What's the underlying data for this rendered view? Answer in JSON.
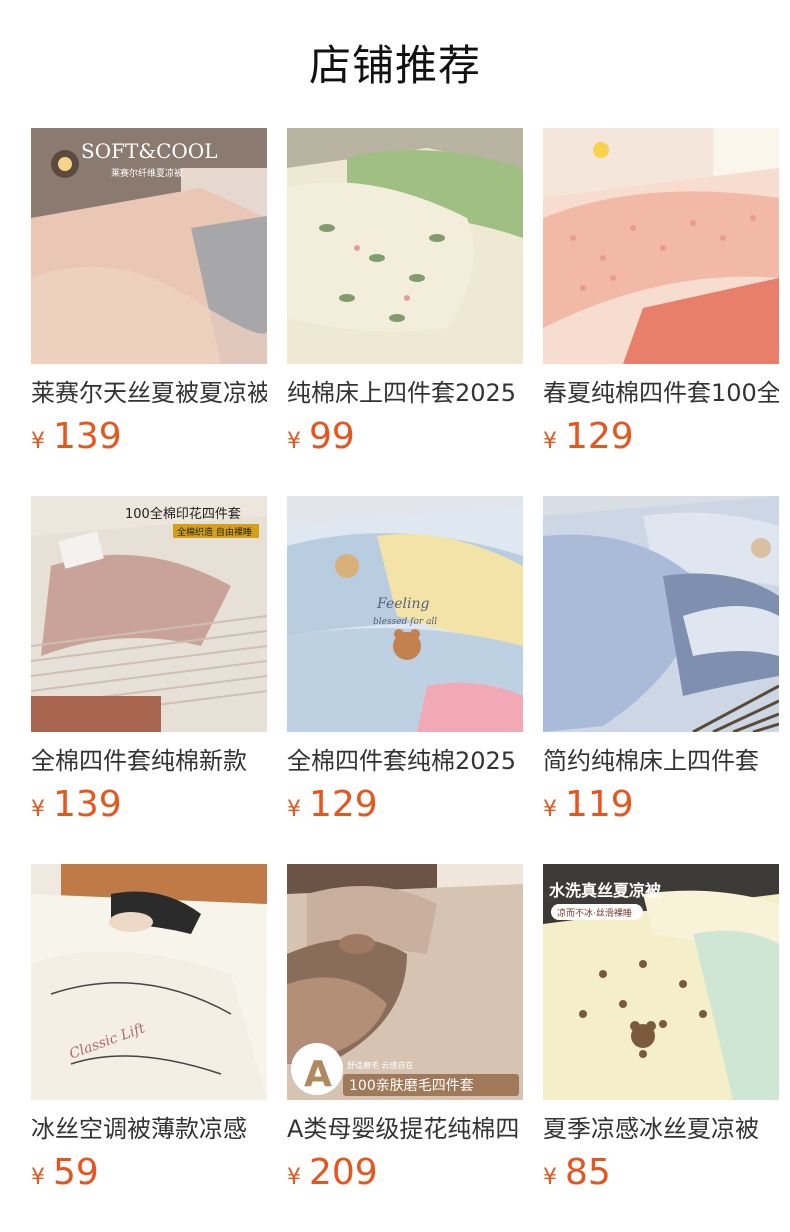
{
  "page": {
    "title": "店铺推荐"
  },
  "currency_symbol": "¥",
  "products": [
    {
      "name": "莱赛尔天丝夏被夏凉被",
      "price": "139",
      "image_text": {
        "headline": "SOFT&COOL",
        "sub": "莱赛尔纤维夏凉被"
      },
      "palette": [
        "#e9c7b4",
        "#a7a6a8",
        "#5b4a3f"
      ],
      "icon": "bedding-photo-icon"
    },
    {
      "name": "纯棉床上四件套2025",
      "price": "99",
      "image_text": {},
      "palette": [
        "#efe9d4",
        "#9fbf83",
        "#6f8f5a"
      ],
      "icon": "bedding-photo-icon"
    },
    {
      "name": "春夏纯棉四件套100全",
      "price": "129",
      "image_text": {},
      "palette": [
        "#f2b9a6",
        "#e77f6b",
        "#f7dcd0"
      ],
      "icon": "bedding-photo-icon"
    },
    {
      "name": "全棉四件套纯棉新款",
      "price": "139",
      "image_text": {
        "headline": "100全棉印花四件套",
        "sub": "全棉织造 自由裸睡"
      },
      "palette": [
        "#c9a39a",
        "#e7e0d6",
        "#8f6d63"
      ],
      "icon": "bedding-photo-icon"
    },
    {
      "name": "全棉四件套纯棉2025",
      "price": "129",
      "image_text": {
        "headline": "Feeling",
        "sub": "blessed for all"
      },
      "palette": [
        "#b8cde0",
        "#f4e3a6",
        "#c2814f"
      ],
      "icon": "bedding-photo-icon"
    },
    {
      "name": "简约纯棉床上四件套",
      "price": "119",
      "image_text": {},
      "palette": [
        "#a9bbd9",
        "#dfe6ef",
        "#7e8fb0"
      ],
      "icon": "bedding-photo-icon"
    },
    {
      "name": "冰丝空调被薄款凉感",
      "price": "59",
      "image_text": {
        "headline": "Classic Lift",
        "sub": ""
      },
      "palette": [
        "#f7f4ec",
        "#c07a48",
        "#e7e1d3"
      ],
      "icon": "bedding-photo-icon"
    },
    {
      "name": "A类母婴级提花纯棉四",
      "price": "209",
      "image_text": {
        "badge": "A",
        "headline": "100亲肤磨毛四件套",
        "sub": "舒适磨毛 云感自在"
      },
      "palette": [
        "#b48f78",
        "#d7c3b2",
        "#8a6c5a"
      ],
      "icon": "bedding-photo-icon"
    },
    {
      "name": "夏季凉感冰丝夏凉被",
      "price": "85",
      "image_text": {
        "headline": "水洗真丝夏凉被",
        "sub": "凉而不冰·丝滑裸睡"
      },
      "palette": [
        "#f4efc9",
        "#cfe6d4",
        "#7b5a3c"
      ],
      "icon": "bedding-photo-icon"
    }
  ]
}
